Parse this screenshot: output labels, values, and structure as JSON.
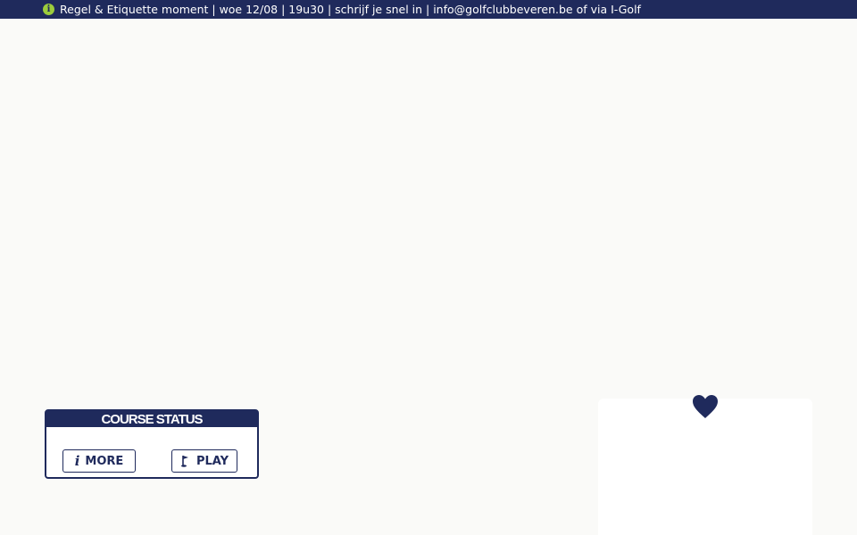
{
  "topbar": {
    "icon": "info-icon",
    "message_prefix": "Regel & Etiquette moment | woe 12/08 | 19u30 | schrijf je snel in | ",
    "email": "info@golfclubbeveren.be",
    "message_suffix": " of via I-Golf"
  },
  "course_status": {
    "title": "COURSE STATUS",
    "more_label": "MORE",
    "more_icon": "info-i-icon",
    "play_label": "PLAY",
    "play_icon": "golf-flag-icon"
  },
  "favorite": {
    "icon": "heart-icon"
  },
  "colors": {
    "navy": "#1f2a5c",
    "accent_green": "#9ccc3c",
    "background": "#fafaf8",
    "card": "#ffffff"
  }
}
